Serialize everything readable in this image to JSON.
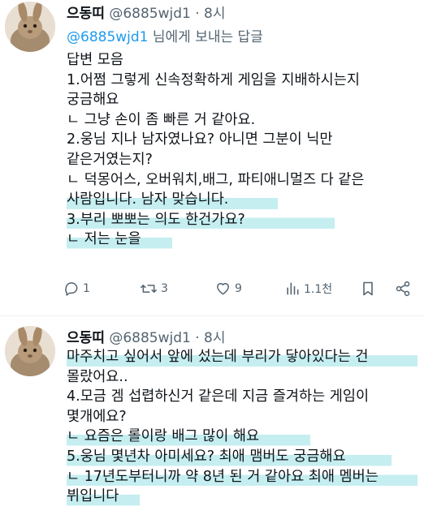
{
  "tweet1": {
    "display_name": "으동띠",
    "handle_time": "@6885wjd1 · 8시",
    "replying": {
      "mention": "@6885wjd1",
      "suffix": " 님에게 보내는 답글"
    },
    "lines": [
      "답변 모음",
      "1.어쩜 그렇게 신속정확하게 게임을 지배하시는지",
      "궁금해요",
      "ㄴ 그냥 손이 좀 빠른 거 같아요.",
      "2.웅님 지나 남자였나요? 아니면 그분이 닉만",
      "같은거였는지?",
      "ㄴ 덕몽어스, 오버워치,배그, 파티애니멀즈 다 같은",
      "사람입니다. 남자 맞습니다.",
      "3.부리 뽀뽀는 의도 한건가요?",
      "ㄴ 저는 눈을"
    ],
    "actions": {
      "reply": "1",
      "retweet": "3",
      "like": "9",
      "views": "1.1천"
    }
  },
  "tweet2": {
    "display_name": "으동띠",
    "handle_time": "@6885wjd1 · 8시",
    "lines": [
      "마주치고 싶어서 앞에 섰는데 부리가 닿아있다는 건",
      "몰랐어요..",
      "4.모금 겜 섭렵하신거 같은데 지금 즐겨하는 게임이",
      "몇개에요?",
      "ㄴ 요즘은 롤이랑 배그 많이 해요",
      "5.웅님 몇년차 아미세요? 최애 맴버도 궁금해요",
      "ㄴ 17년도부터니까 약 8년 된 거 같아요 최애 멤버는",
      "뷔입니다"
    ]
  },
  "colors": {
    "text": "#0f1419",
    "secondary": "#536471",
    "link": "#1d9bf0",
    "highlight": "#96e1e6"
  }
}
